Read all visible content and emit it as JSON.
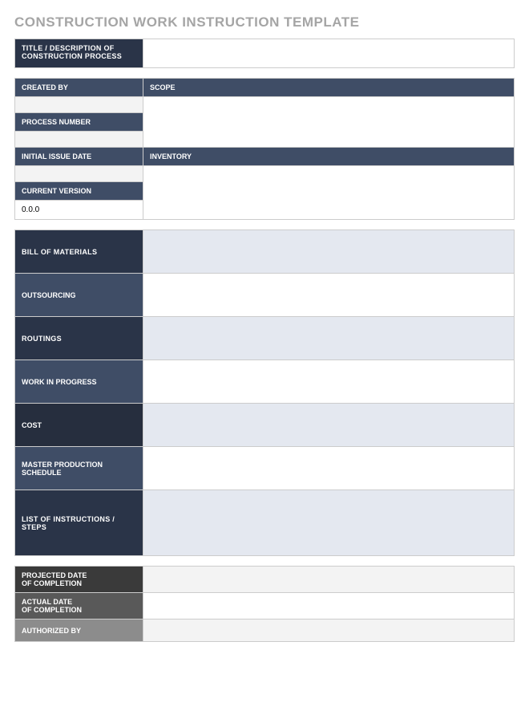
{
  "page_title": "CONSTRUCTION WORK INSTRUCTION TEMPLATE",
  "header_row": {
    "title_label": "TITLE / DESCRIPTION OF CONSTRUCTION PROCESS",
    "title_value": ""
  },
  "meta": {
    "created_by_label": "CREATED BY",
    "created_by_value": "",
    "scope_label": "SCOPE",
    "scope_value": "",
    "process_number_label": "PROCESS NUMBER",
    "process_number_value": "",
    "initial_issue_date_label": "INITIAL ISSUE DATE",
    "initial_issue_date_value": "",
    "inventory_label": "INVENTORY",
    "inventory_value": "",
    "current_version_label": "CURRENT VERSION",
    "current_version_value": "0.0.0"
  },
  "sections": {
    "bom_label": "BILL OF MATERIALS",
    "bom_value": "",
    "outsourcing_label": "OUTSOURCING",
    "outsourcing_value": "",
    "routings_label": "ROUTINGS",
    "routings_value": "",
    "wip_label": "WORK IN PROGRESS",
    "wip_value": "",
    "cost_label": "COST",
    "cost_value": "",
    "mps_label": "MASTER PRODUCTION SCHEDULE",
    "mps_value": "",
    "steps_label": "LIST OF INSTRUCTIONS / STEPS",
    "steps_value": ""
  },
  "footer": {
    "projected_label_1": "PROJECTED DATE",
    "projected_label_2": "OF COMPLETION",
    "projected_value": "",
    "actual_label_1": "ACTUAL DATE",
    "actual_label_2": "OF COMPLETION",
    "actual_value": "",
    "authorized_label": "AUTHORIZED BY",
    "authorized_value": ""
  }
}
